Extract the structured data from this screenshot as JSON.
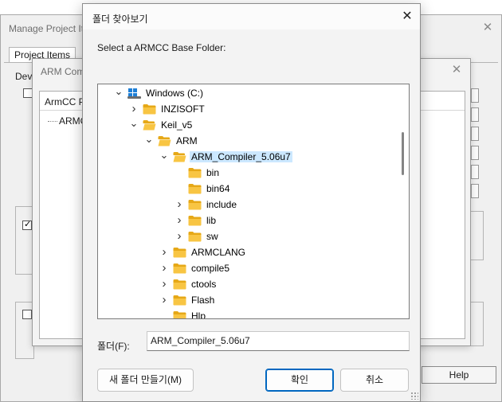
{
  "manage_window": {
    "title": "Manage Project It",
    "tab_label": "Project Items",
    "dev_label": "Deve",
    "help_button": "Help"
  },
  "arm_window": {
    "title": "ARM Com",
    "list_header": "ArmCC P",
    "list_item": "ARMC"
  },
  "dialog": {
    "title": "폴더 찾아보기",
    "prompt": "Select a ARMCC Base Folder:",
    "folder_label": "폴더(F):",
    "folder_value": "ARM_Compiler_5.06u7",
    "new_folder_button": "새 폴더 만들기(M)",
    "ok_button": "확인",
    "cancel_button": "취소"
  },
  "tree": [
    {
      "label": "Windows (C:)",
      "expanded": true,
      "drive": true
    },
    {
      "label": "INZISOFT",
      "expanded": false
    },
    {
      "label": "Keil_v5",
      "expanded": true
    },
    {
      "label": "ARM",
      "expanded": true
    },
    {
      "label": "ARM_Compiler_5.06u7",
      "expanded": true,
      "selected": true
    },
    {
      "label": "bin"
    },
    {
      "label": "bin64"
    },
    {
      "label": "include",
      "expanded": false
    },
    {
      "label": "lib",
      "expanded": false
    },
    {
      "label": "sw",
      "expanded": false
    },
    {
      "label": "ARMCLANG",
      "expanded": false
    },
    {
      "label": "compile5",
      "expanded": false
    },
    {
      "label": "ctools",
      "expanded": false
    },
    {
      "label": "Flash",
      "expanded": false
    },
    {
      "label": "Hlp"
    }
  ],
  "colors": {
    "selection": "#cce8ff",
    "folder": "#f8c543",
    "accent": "#0067c0"
  }
}
